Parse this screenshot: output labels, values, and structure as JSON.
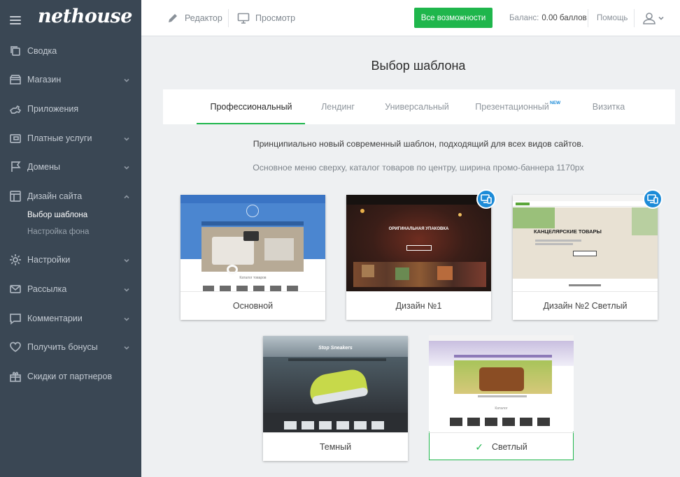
{
  "app": {
    "logo_text": "nethouse"
  },
  "sidebar": {
    "items": [
      {
        "label": "Сводка",
        "icon": "copy-icon",
        "has_chevron": false
      },
      {
        "label": "Магазин",
        "icon": "store-icon",
        "has_chevron": true
      },
      {
        "label": "Приложения",
        "icon": "puzzle-icon",
        "has_chevron": false
      },
      {
        "label": "Платные услуги",
        "icon": "wallet-icon",
        "has_chevron": true
      },
      {
        "label": "Домены",
        "icon": "flag-icon",
        "has_chevron": true
      },
      {
        "label": "Дизайн сайта",
        "icon": "layout-icon",
        "has_chevron": true,
        "expanded": true
      },
      {
        "label": "Настройки",
        "icon": "gear-icon",
        "has_chevron": true
      },
      {
        "label": "Рассылка",
        "icon": "mail-icon",
        "has_chevron": true
      },
      {
        "label": "Комментарии",
        "icon": "comment-icon",
        "has_chevron": true
      },
      {
        "label": "Получить бонусы",
        "icon": "heart-icon",
        "has_chevron": true
      },
      {
        "label": "Скидки от партнеров",
        "icon": "gift-icon",
        "has_chevron": false
      }
    ],
    "design_submenu": [
      {
        "label": "Выбор шаблона",
        "active": true
      },
      {
        "label": "Настройка фона",
        "active": false
      }
    ]
  },
  "topbar": {
    "editor_label": "Редактор",
    "preview_label": "Просмотр",
    "all_features_label": "Все возможности",
    "balance_label": "Баланс:",
    "balance_value": "0.00 баллов",
    "help_label": "Помощь"
  },
  "main": {
    "title": "Выбор шаблона",
    "tabs": [
      {
        "label": "Профессиональный",
        "active": true
      },
      {
        "label": "Лендинг",
        "active": false
      },
      {
        "label": "Универсальный",
        "active": false
      },
      {
        "label": "Презентационный",
        "active": false,
        "badge": "NEW"
      },
      {
        "label": "Визитка",
        "active": false
      }
    ],
    "description_primary": "Принципиально новый современный шаблон, подходящий для всех видов сайтов.",
    "description_secondary": "Основное меню сверху, каталог товаров по центру, ширина промо-баннера 1170px",
    "templates": [
      {
        "label": "Основной",
        "selected": false,
        "responsive_badge": false,
        "thumb_caption": "Каталог товаров"
      },
      {
        "label": "Дизайн №1",
        "selected": false,
        "responsive_badge": true,
        "thumb_caption": "ОРИГИНАЛЬНАЯ УПАКОВКА"
      },
      {
        "label": "Дизайн №2 Светлый",
        "selected": false,
        "responsive_badge": true,
        "thumb_caption": "КАНЦЕЛЯРСКИЕ ТОВАРЫ"
      },
      {
        "label": "Темный",
        "selected": false,
        "responsive_badge": false,
        "thumb_caption": "Stop Sneakers"
      },
      {
        "label": "Светлый",
        "selected": true,
        "responsive_badge": false,
        "thumb_caption": "Каталог"
      }
    ]
  },
  "colors": {
    "accent_green": "#1fb64c",
    "sidebar_bg": "#3a4754",
    "badge_blue": "#1c8bd8"
  }
}
